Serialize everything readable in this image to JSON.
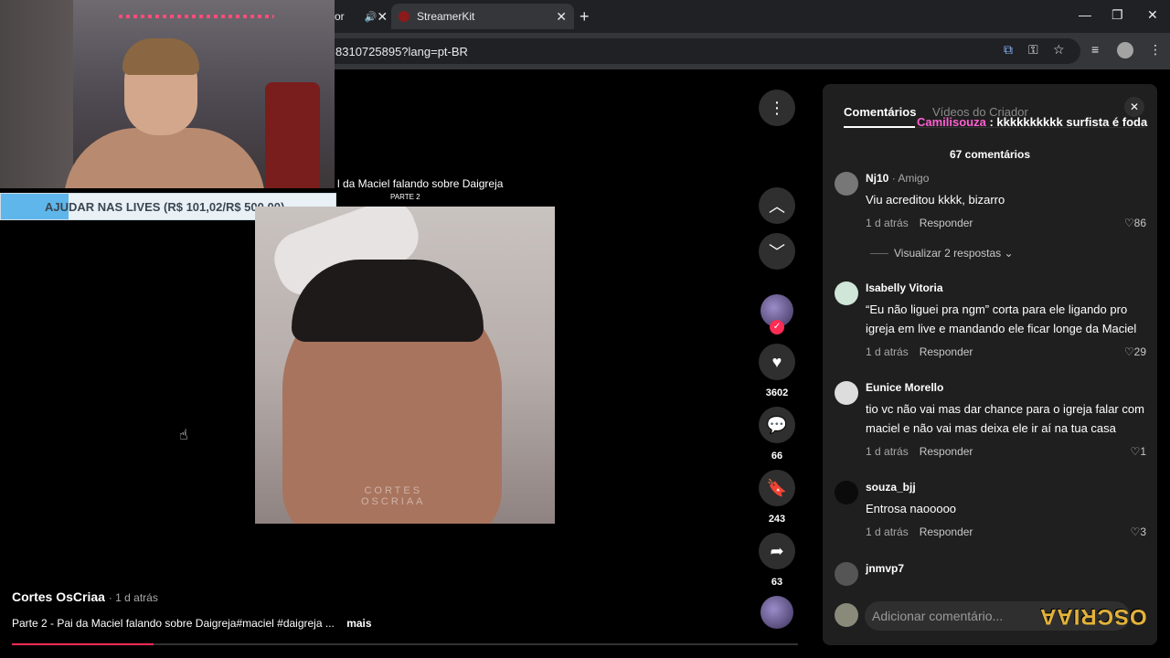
{
  "browser": {
    "tab1_title": "cor",
    "tab2_title": "StreamerKit",
    "url": "8310725895?lang=pt-BR"
  },
  "stream_goal": {
    "text": "AJUDAR NAS LIVES (R$ 101,02/R$ 500,00)",
    "raised": 101.02,
    "target": 500.0
  },
  "video": {
    "title": "l da Maciel falando sobre Daigreja",
    "part": "PARTE 2",
    "watermark_line1": "CORTES",
    "watermark_line2": "OSCRIAA",
    "author": "Cortes OsCriaa",
    "posted": "· 1 d atrás",
    "caption": "Parte 2 - Pai da Maciel falando sobre Daigreja#maciel #daigreja ...",
    "more": "mais",
    "progress": 0.18
  },
  "actions": {
    "likes": "3602",
    "comments": "66",
    "saves": "243",
    "shares": "63"
  },
  "panel": {
    "tab_comments": "Comentários",
    "tab_videos": "Vídeos do Criador",
    "comment_count": "67 comentários",
    "input_placeholder": "Adicionar comentário...",
    "logo": "OSCRIAA",
    "comments": [
      {
        "user": "Nj10",
        "tag": " · Amigo",
        "text": "Viu acreditou kkkk, bizarro",
        "time": "1 d atrás",
        "reply": "Responder",
        "likes": "86"
      },
      {
        "user": "Isabelly Vitoria",
        "tag": "",
        "text": "“Eu não liguei pra ngm” corta para ele ligando pro igreja em live e mandando ele ficar longe da Maciel",
        "time": "1 d atrás",
        "reply": "Responder",
        "likes": "29"
      },
      {
        "user": "Eunice Morello",
        "tag": "",
        "text": "tio vc não vai mas dar chance para o igreja falar com maciel e não vai mas deixa ele ir aí na tua casa",
        "time": "1 d atrás",
        "reply": "Responder",
        "likes": "1"
      },
      {
        "user": "souza_bjj",
        "tag": "",
        "text": "Entrosa naooooo",
        "time": "1 d atrás",
        "reply": "Responder",
        "likes": "3"
      },
      {
        "user": "jnmvp7",
        "tag": "",
        "text": "",
        "time": "",
        "reply": "",
        "likes": ""
      }
    ],
    "view_replies": "Visualizar 2 respostas"
  },
  "chat_overlay": {
    "user": "Camilisouza",
    "message": ": kkkkkkkkkk surfista é foda"
  },
  "colors": {
    "accent": "#fe2c55",
    "panel_bg": "#1f1f1f",
    "goal_fill": "#5fb6ea"
  }
}
